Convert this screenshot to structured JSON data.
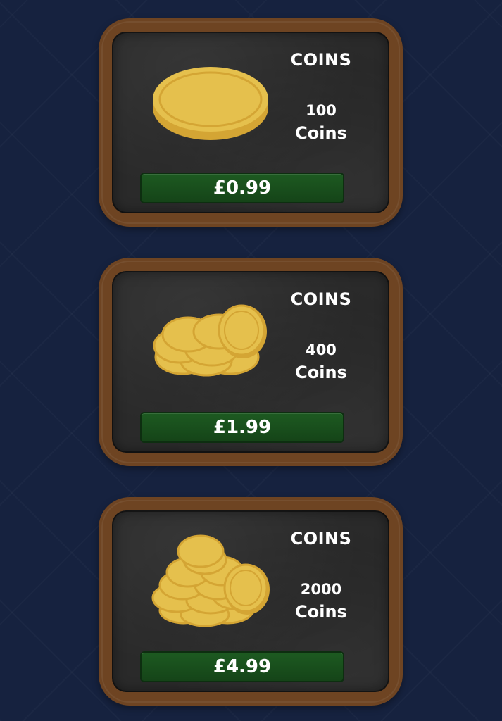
{
  "colors": {
    "background": "#16223f",
    "frame": "#6e4422",
    "board": "#2a2a2a",
    "button": "#1d5a21",
    "coin": "#e5c04d",
    "coin_edge": "#d4a534"
  },
  "packs": [
    {
      "title": "COINS",
      "amount": "100",
      "unit": "Coins",
      "price": "£0.99",
      "icon": "single-coin-icon"
    },
    {
      "title": "COINS",
      "amount": "400",
      "unit": "Coins",
      "price": "£1.99",
      "icon": "small-coin-pile-icon"
    },
    {
      "title": "COINS",
      "amount": "2000",
      "unit": "Coins",
      "price": "£4.99",
      "icon": "large-coin-pile-icon"
    }
  ]
}
